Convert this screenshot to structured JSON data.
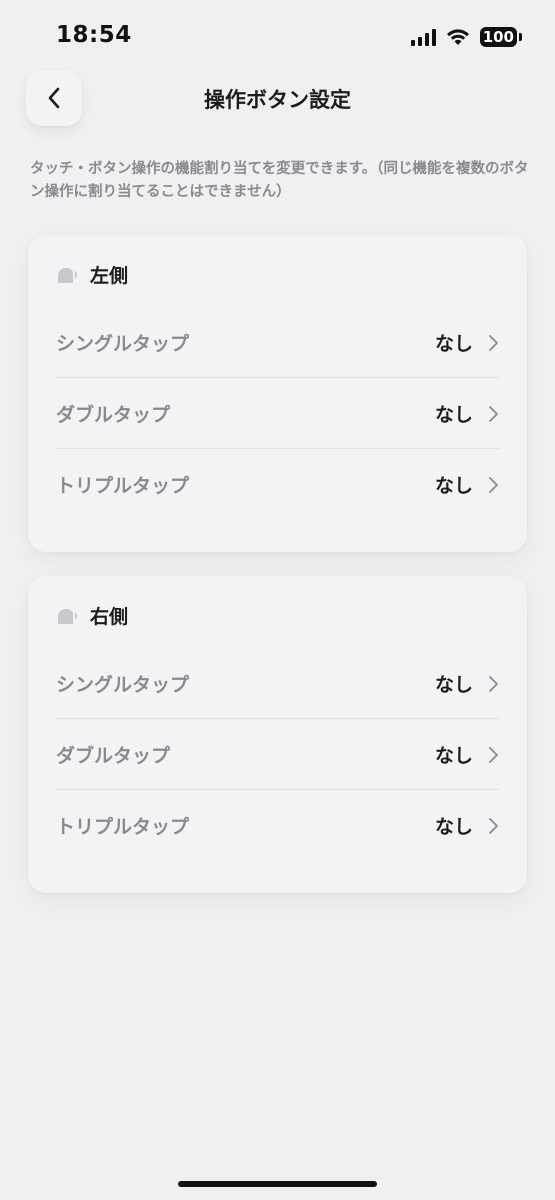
{
  "status_bar": {
    "time": "18:54",
    "battery": "100"
  },
  "header": {
    "title": "操作ボタン設定"
  },
  "description": "タッチ・ボタン操作の機能割り当てを変更できます。（同じ機能を複数のボタン操作に割り当てることはできません）",
  "sections": [
    {
      "title": "左側",
      "rows": [
        {
          "label": "シングルタップ",
          "value": "なし"
        },
        {
          "label": "ダブルタップ",
          "value": "なし"
        },
        {
          "label": "トリプルタップ",
          "value": "なし"
        }
      ]
    },
    {
      "title": "右側",
      "rows": [
        {
          "label": "シングルタップ",
          "value": "なし"
        },
        {
          "label": "ダブルタップ",
          "value": "なし"
        },
        {
          "label": "トリプルタップ",
          "value": "なし"
        }
      ]
    }
  ],
  "icons": {
    "back": "chevron-left-icon",
    "row": "chevron-right-icon",
    "side": "earbud-icon",
    "status": [
      "cellular-signal-icon",
      "wifi-icon",
      "battery-icon"
    ]
  },
  "colors": {
    "background": "#f0f0f2",
    "card": "#f3f3f5",
    "label_gray": "#8a8a8e",
    "text_dark": "#1c1c1e",
    "divider": "#e2e2e6",
    "side_icon": "#c5c9cf"
  }
}
